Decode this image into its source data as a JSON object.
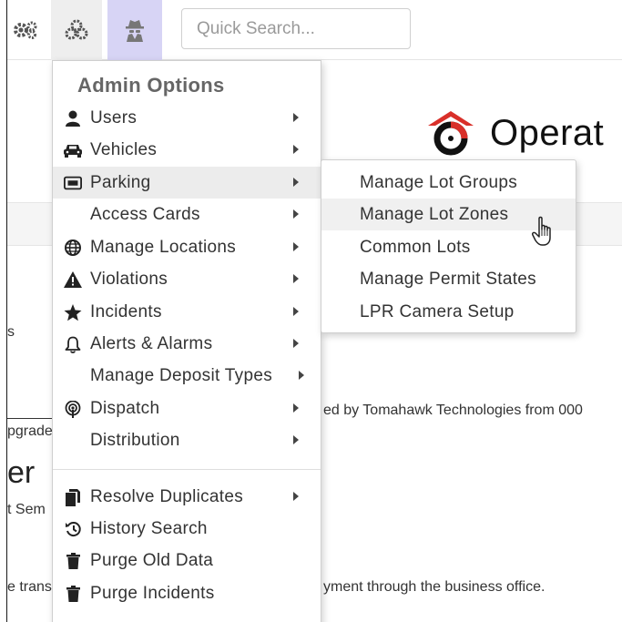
{
  "toolbar": {
    "buttons": [
      {
        "name": "gears-icon"
      },
      {
        "name": "cogs-icon"
      },
      {
        "name": "spy-icon"
      }
    ],
    "search": {
      "placeholder": "Quick Search...",
      "button_icon": "search-icon"
    }
  },
  "brand": {
    "text": "Operat"
  },
  "background": {
    "line_s": "s",
    "line_upgrade": "pgrade",
    "line_tomahawk": "ed by Tomahawk Technologies from 000",
    "heading": "er",
    "line_sem": "t Sem",
    "line_trans": "e trans",
    "line_payment": "yment through the business office."
  },
  "menu": {
    "header": "Admin Options",
    "items": [
      {
        "label": "Users",
        "icon": "user-icon",
        "submenu": true
      },
      {
        "label": "Vehicles",
        "icon": "car-icon",
        "submenu": true
      },
      {
        "label": "Parking",
        "icon": "parking-ticket-icon",
        "submenu": true,
        "active": true
      },
      {
        "label": "Access Cards",
        "icon": "",
        "submenu": true
      },
      {
        "label": "Manage Locations",
        "icon": "globe-icon",
        "submenu": true
      },
      {
        "label": "Violations",
        "icon": "warning-icon",
        "submenu": true
      },
      {
        "label": "Incidents",
        "icon": "star-icon",
        "submenu": true
      },
      {
        "label": "Alerts & Alarms",
        "icon": "bell-icon",
        "submenu": true
      },
      {
        "label": "Manage Deposit Types",
        "icon": "",
        "submenu": true
      },
      {
        "label": "Dispatch",
        "icon": "podcast-icon",
        "submenu": true
      },
      {
        "label": "Distribution",
        "icon": "",
        "submenu": true
      },
      {
        "label": "Resolve Duplicates",
        "icon": "copy-icon",
        "submenu": true
      },
      {
        "label": "History Search",
        "icon": "history-icon",
        "submenu": false
      },
      {
        "label": "Purge Old Data",
        "icon": "trash-icon",
        "submenu": false
      },
      {
        "label": "Purge Incidents",
        "icon": "trash-icon",
        "submenu": false
      }
    ]
  },
  "submenu": {
    "items": [
      {
        "label": "Manage Lot Groups"
      },
      {
        "label": "Manage Lot Zones",
        "hover": true
      },
      {
        "label": "Common Lots"
      },
      {
        "label": "Manage Permit States"
      },
      {
        "label": "LPR Camera Setup"
      }
    ]
  },
  "colors": {
    "spy_button_bg": "#d7d4f5",
    "active_item_bg": "#ececec",
    "logo_red": "#d9302a"
  }
}
